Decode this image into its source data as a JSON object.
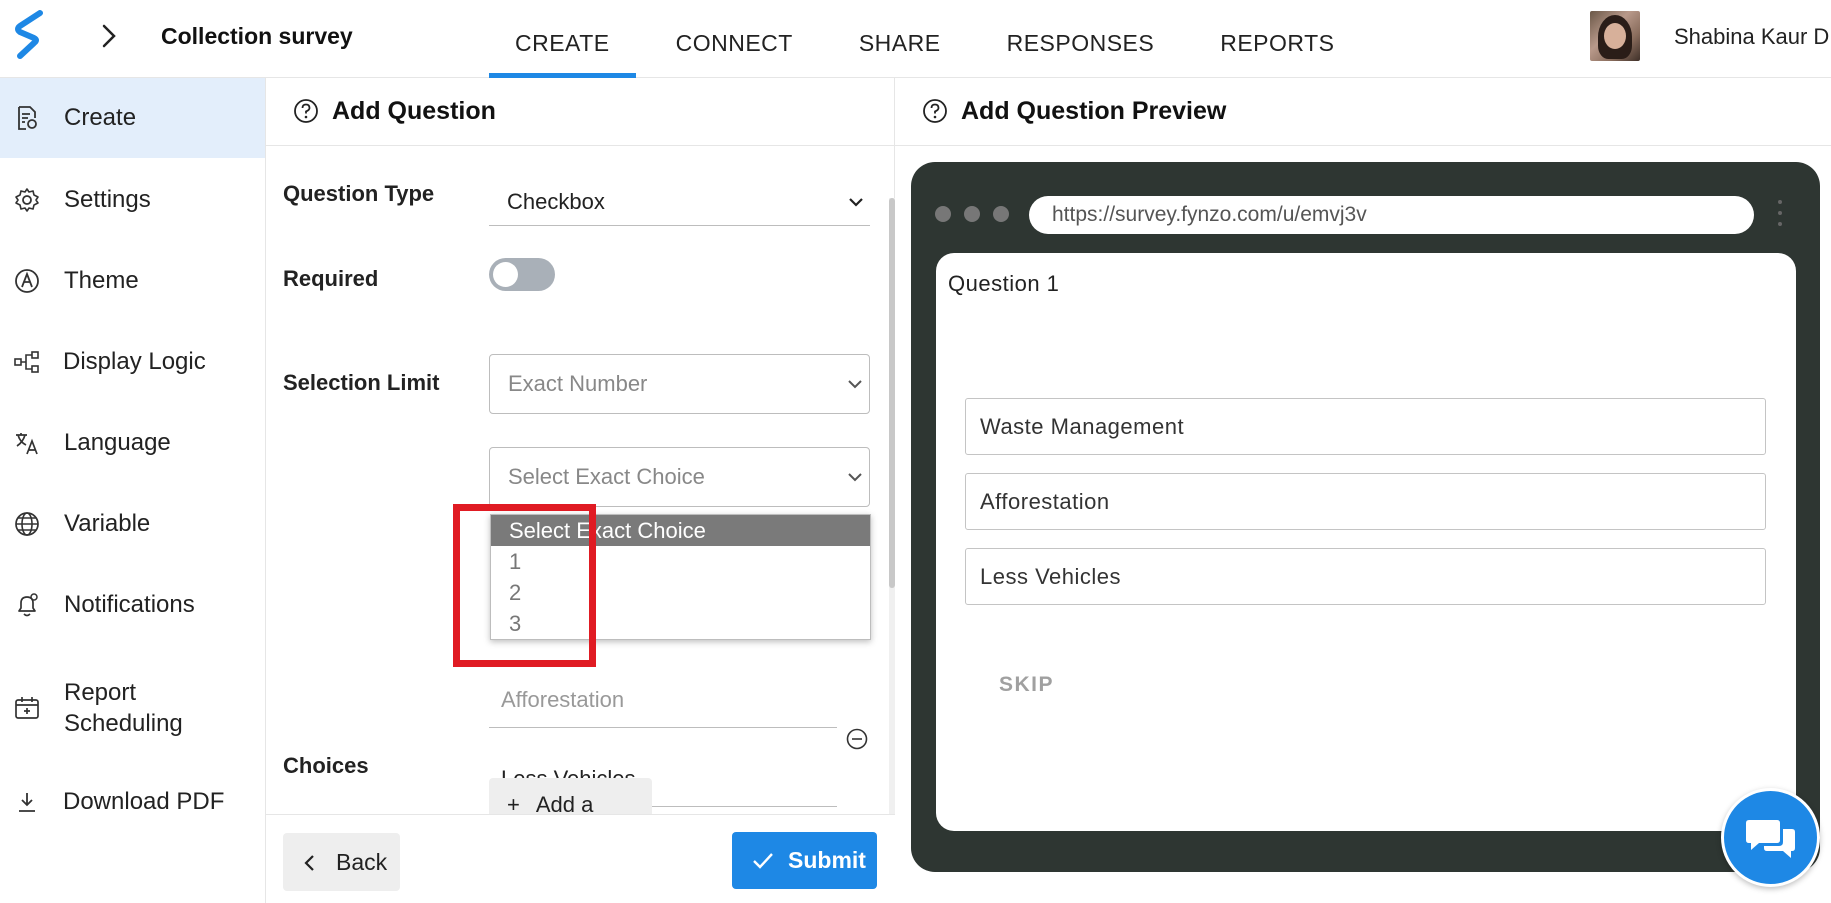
{
  "topbar": {
    "survey_title": "Collection survey",
    "tabs": [
      {
        "label": "CREATE",
        "active": true
      },
      {
        "label": "CONNECT"
      },
      {
        "label": "SHARE"
      },
      {
        "label": "RESPONSES"
      },
      {
        "label": "REPORTS"
      }
    ],
    "user_name": "Shabina Kaur D"
  },
  "sidebar": {
    "items": [
      {
        "label": "Create",
        "icon": "create-form-icon",
        "active": true
      },
      {
        "label": "Settings",
        "icon": "gear-icon"
      },
      {
        "label": "Theme",
        "icon": "theme-icon"
      },
      {
        "label": "Display Logic",
        "icon": "flow-icon"
      },
      {
        "label": "Language",
        "icon": "translate-icon"
      },
      {
        "label": "Variable",
        "icon": "globe-icon"
      },
      {
        "label": "Notifications",
        "icon": "bell-icon"
      },
      {
        "label": "Report Scheduling",
        "line1": "Report",
        "line2": "Scheduling",
        "icon": "calendar-icon"
      },
      {
        "label": "Download PDF",
        "icon": "download-icon"
      }
    ]
  },
  "editor": {
    "title": "Add Question",
    "question_type_label": "Question Type",
    "question_type_value": "Checkbox",
    "required_label": "Required",
    "required_on": false,
    "selection_limit_label": "Selection Limit",
    "selection_limit_value": "Exact Number",
    "exact_choice_placeholder": "Select Exact Choice",
    "dropdown_options": [
      "Select Exact Choice",
      "1",
      "2",
      "3"
    ],
    "choices_label": "Choices",
    "choices": [
      "Afforestation",
      "Less Vehicles"
    ],
    "add_choice_label": "Add a choice",
    "back_label": "Back",
    "submit_label": "Submit"
  },
  "preview": {
    "title": "Add Question Preview",
    "url": "https://survey.fynzo.com/u/emvj3v",
    "question_title": "Question 1",
    "options": [
      "Waste Management",
      "Afforestation",
      "Less Vehicles"
    ],
    "skip_label": "SKIP"
  },
  "colors": {
    "accent": "#1e88e5",
    "sidebar_active_bg": "#e3eefb",
    "highlight": "#e01b23",
    "browser_frame": "#2e3632"
  }
}
